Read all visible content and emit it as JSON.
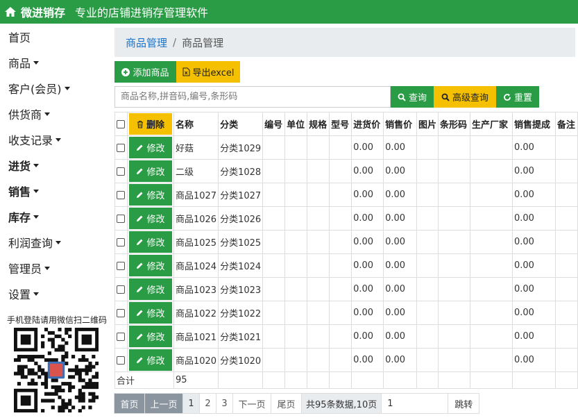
{
  "header": {
    "brand": "微进销存",
    "slogan": "专业的店铺进销存管理软件"
  },
  "sidebar": {
    "items": [
      {
        "label": "首页",
        "caret": false,
        "bold": false
      },
      {
        "label": "商品",
        "caret": true,
        "bold": false
      },
      {
        "label": "客户(会员)",
        "caret": true,
        "bold": false
      },
      {
        "label": "供货商",
        "caret": true,
        "bold": false
      },
      {
        "label": "收支记录",
        "caret": true,
        "bold": false
      },
      {
        "label": "进货",
        "caret": true,
        "bold": true
      },
      {
        "label": "销售",
        "caret": true,
        "bold": true
      },
      {
        "label": "库存",
        "caret": true,
        "bold": true
      },
      {
        "label": "利润查询",
        "caret": true,
        "bold": false
      },
      {
        "label": "管理员",
        "caret": true,
        "bold": false
      },
      {
        "label": "设置",
        "caret": true,
        "bold": false
      }
    ],
    "qr_label": "手机登陆请用微信扫二维码"
  },
  "breadcrumb": {
    "parent": "商品管理",
    "current": "商品管理"
  },
  "toolbar": {
    "add_label": "添加商品",
    "export_label": "导出excel"
  },
  "search": {
    "placeholder": "商品名称,拼音码,编号,条形码",
    "value": "",
    "query_label": "查询",
    "advanced_label": "高级查询",
    "reset_label": "重置"
  },
  "table": {
    "delete_label": "删除",
    "edit_label": "修改",
    "columns": [
      "名称",
      "分类",
      "编号",
      "单位",
      "规格",
      "型号",
      "进货价",
      "销售价",
      "图片",
      "条形码",
      "生产厂家",
      "销售提成",
      "备注"
    ],
    "rows": [
      {
        "name": "好菇",
        "category": "分类1029",
        "purchase_price": "0.00",
        "sale_price": "0.00",
        "commission": "0.00"
      },
      {
        "name": "二级",
        "category": "分类1028",
        "purchase_price": "0.00",
        "sale_price": "0.00",
        "commission": "0.00"
      },
      {
        "name": "商品1027",
        "category": "分类1027",
        "purchase_price": "0.00",
        "sale_price": "0.00",
        "commission": "0.00"
      },
      {
        "name": "商品1026",
        "category": "分类1026",
        "purchase_price": "0.00",
        "sale_price": "0.00",
        "commission": "0.00"
      },
      {
        "name": "商品1025",
        "category": "分类1025",
        "purchase_price": "0.00",
        "sale_price": "0.00",
        "commission": "0.00"
      },
      {
        "name": "商品1024",
        "category": "分类1024",
        "purchase_price": "0.00",
        "sale_price": "0.00",
        "commission": "0.00"
      },
      {
        "name": "商品1023",
        "category": "分类1023",
        "purchase_price": "0.00",
        "sale_price": "0.00",
        "commission": "0.00"
      },
      {
        "name": "商品1022",
        "category": "分类1022",
        "purchase_price": "0.00",
        "sale_price": "0.00",
        "commission": "0.00"
      },
      {
        "name": "商品1021",
        "category": "分类1021",
        "purchase_price": "0.00",
        "sale_price": "0.00",
        "commission": "0.00"
      },
      {
        "name": "商品1020",
        "category": "分类1020",
        "purchase_price": "0.00",
        "sale_price": "0.00",
        "commission": "0.00"
      }
    ],
    "total_label": "合计",
    "total_value": "95"
  },
  "pager": {
    "first": "首页",
    "prev": "上一页",
    "pages": [
      "1",
      "2",
      "3"
    ],
    "next": "下一页",
    "last": "尾页",
    "info": "共95条数据,10页",
    "jump_value": "1",
    "jump_label": "跳转"
  },
  "colors": {
    "green": "#2a9c45",
    "yellow": "#f5c000",
    "link": "#1a73c9",
    "pager_dark": "#8a95a0"
  }
}
